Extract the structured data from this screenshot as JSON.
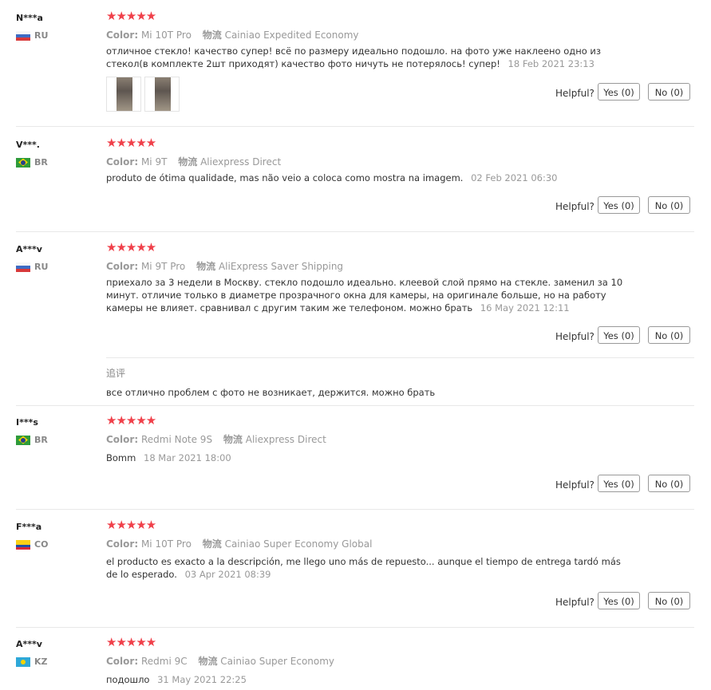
{
  "labels": {
    "color": "Color:",
    "shipping": "物流",
    "helpful": "Helpful?",
    "additional": "追评"
  },
  "reviews": [
    {
      "user": "N***a",
      "country": "RU",
      "stars": "★★★★★",
      "rating": 5,
      "color": "Mi 10T Pro",
      "shipping": "Cainiao Expedited Economy",
      "text": "отличное стекло! качество супер! всё по размеру идеально подошло. на фото уже наклеено одно из стекол(в комплекте 2шт приходят) качество фото ничуть не потерялось! супер!",
      "date": "18 Feb 2021 23:13",
      "yes": "Yes (0)",
      "no": "No (0)"
    },
    {
      "user": "V***.",
      "country": "BR",
      "stars": "★★★★★",
      "rating": 5,
      "color": "Mi 9T",
      "shipping": "Aliexpress Direct",
      "text": "produto de ótima qualidade, mas não veio a coloca como mostra na imagem.",
      "date": "02 Feb 2021 06:30",
      "yes": "Yes (0)",
      "no": "No (0)"
    },
    {
      "user": "A***v",
      "country": "RU",
      "stars": "★★★★★",
      "rating": 5,
      "color": "Mi 9T Pro",
      "shipping": "AliExpress Saver Shipping",
      "text": "приехало за 3 недели в Москву. стекло подошло идеально. клеевой слой прямо на стекле. заменил за 10 минут. отличие только в диаметре прозрачного окна для камеры, на оригинале больше, но на работу камеры не влияет. сравнивал с другим таким же телефоном. можно брать",
      "date": "16 May 2021 12:11",
      "yes": "Yes (0)",
      "no": "No (0)",
      "additional": "все отлично проблем с фото не возникает, держится. можно брать"
    },
    {
      "user": "I***s",
      "country": "BR",
      "stars": "★★★★★",
      "rating": 5,
      "color": "Redmi Note 9S",
      "shipping": "Aliexpress Direct",
      "text": "Bomm",
      "date": "18 Mar 2021 18:00",
      "yes": "Yes (0)",
      "no": "No (0)"
    },
    {
      "user": "F***a",
      "country": "CO",
      "stars": "★★★★★",
      "rating": 5,
      "color": "Mi 10T Pro",
      "shipping": "Cainiao Super Economy Global",
      "text": "el producto es exacto a la descripción, me llego uno más de repuesto... aunque el tiempo de entrega tardó más de lo esperado.",
      "date": "03 Apr 2021 08:39",
      "yes": "Yes (0)",
      "no": "No (0)"
    },
    {
      "user": "A***v",
      "country": "KZ",
      "stars": "★★★★★",
      "rating": 5,
      "color": "Redmi 9C",
      "shipping": "Cainiao Super Economy",
      "text": "подошло",
      "date": "31 May 2021 22:25"
    }
  ]
}
